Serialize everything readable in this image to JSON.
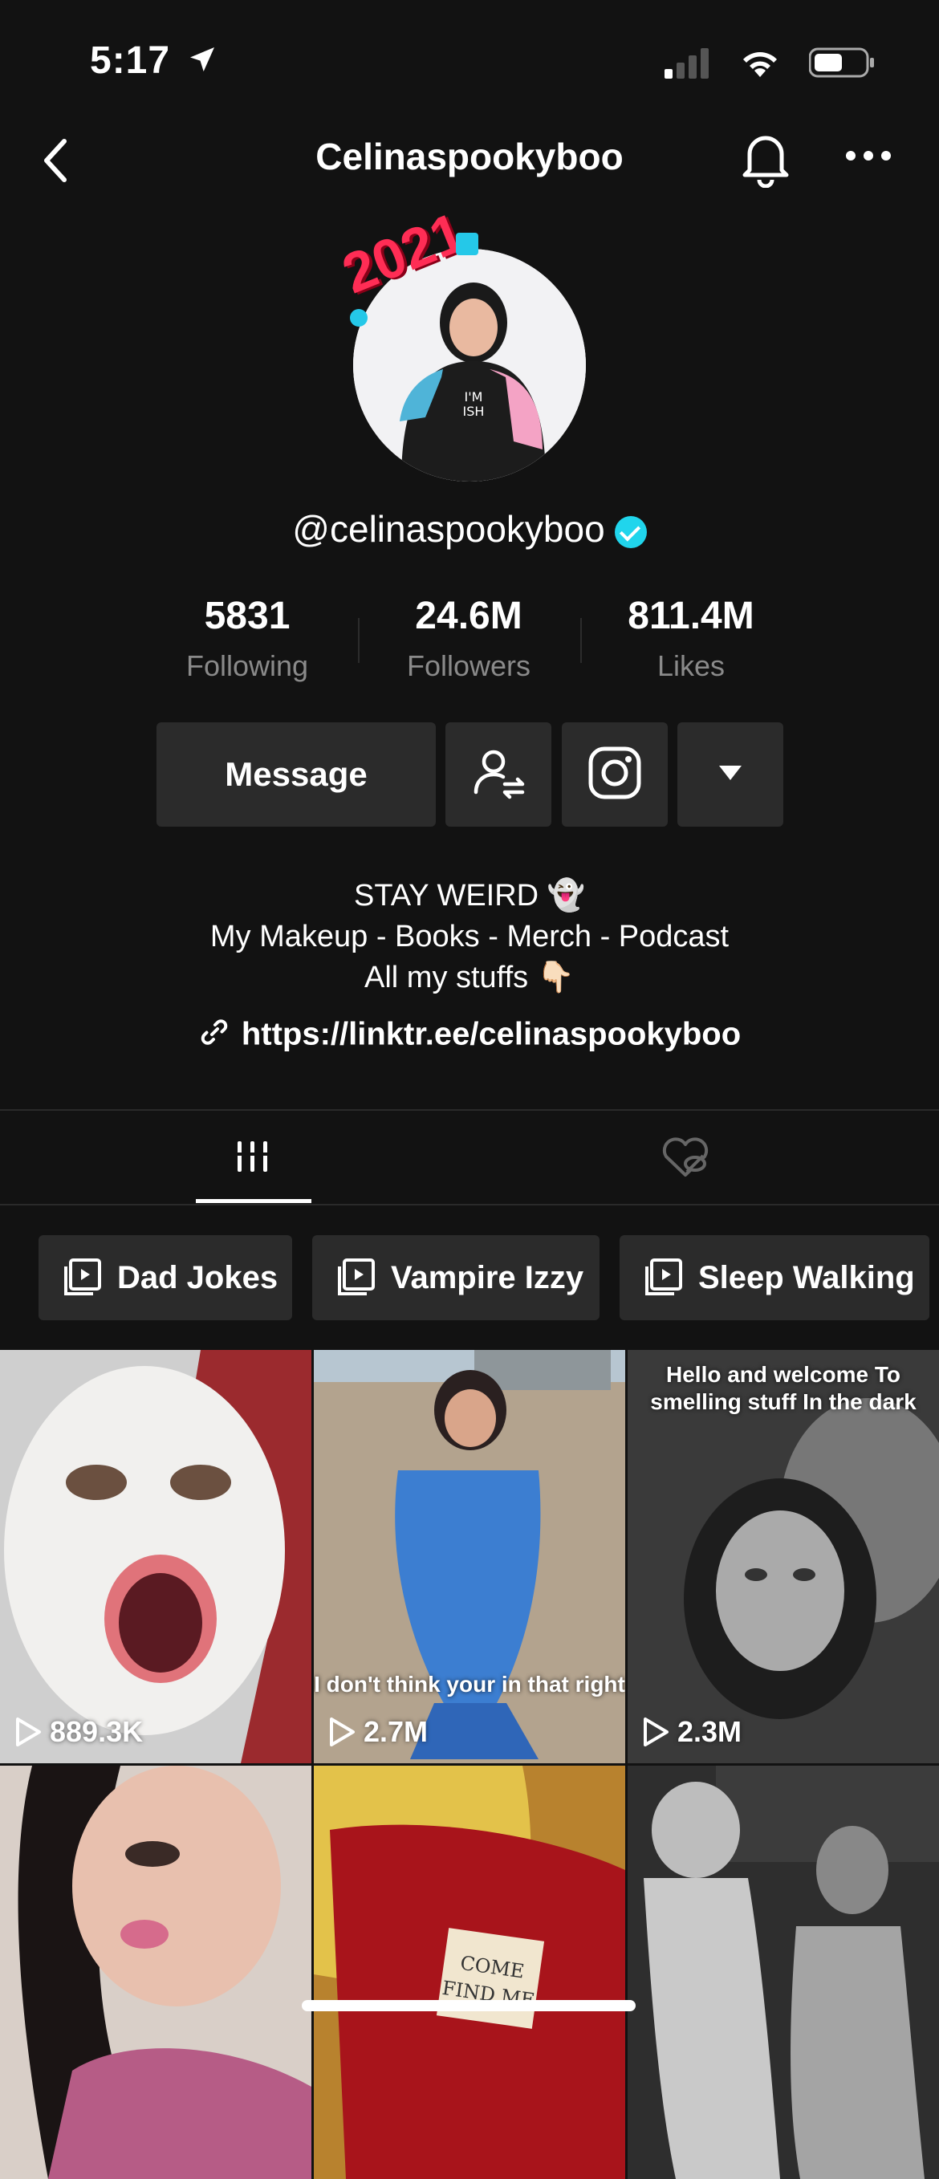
{
  "status": {
    "time": "5:17"
  },
  "nav": {
    "title": "Celinaspookyboo"
  },
  "profile": {
    "avatar_badge": "2021",
    "handle": "@celinaspookyboo",
    "stats": [
      {
        "value": "5831",
        "label": "Following"
      },
      {
        "value": "24.6M",
        "label": "Followers"
      },
      {
        "value": "811.4M",
        "label": "Likes"
      }
    ],
    "message_label": "Message",
    "bio_lines": [
      "STAY WEIRD 👻",
      "My Makeup - Books - Merch - Podcast",
      "All my stuffs 👇🏻"
    ],
    "link": "https://linktr.ee/celinaspookyboo"
  },
  "playlists": [
    "Dad Jokes",
    "Vampire Izzy",
    "Sleep Walking"
  ],
  "videos": [
    {
      "views": "889.3K",
      "caption": ""
    },
    {
      "views": "2.7M",
      "caption": "I don't think your in that right"
    },
    {
      "views": "2.3M",
      "caption": "Hello and welcome To smelling stuff In the dark"
    },
    {
      "views": "",
      "caption": ""
    },
    {
      "views": "",
      "caption": "COME FIND ME"
    },
    {
      "views": "",
      "caption": ""
    }
  ],
  "colors": {
    "background": "#121212",
    "button": "#2b2b2b",
    "verified": "#20d5ec",
    "muted": "#8a8a8a"
  }
}
